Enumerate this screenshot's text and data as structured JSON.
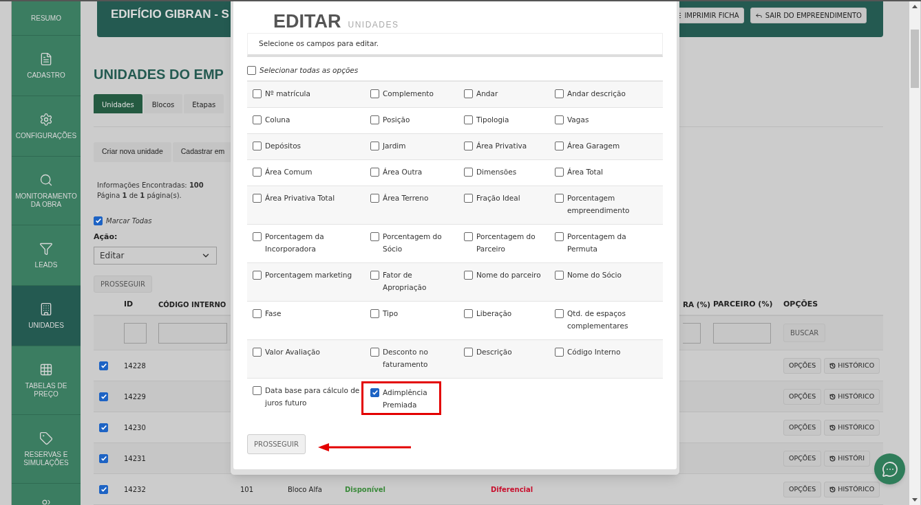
{
  "sidebar": {
    "items": [
      {
        "label": "RESUMO",
        "selected": false
      },
      {
        "label": "CADASTRO",
        "selected": false
      },
      {
        "label": "CONFIGURAÇÕES",
        "selected": false
      },
      {
        "label": "MONITORAMENTO DA OBRA",
        "selected": false
      },
      {
        "label": "LEADS",
        "selected": false
      },
      {
        "label": "UNIDADES",
        "selected": true
      },
      {
        "label": "TABELAS DE PREÇO",
        "selected": false
      },
      {
        "label": "RESERVAS E SIMULAÇÕES",
        "selected": false
      },
      {
        "selected": false
      }
    ]
  },
  "header": {
    "title": "EDIFÍCIO GIBRAN - S",
    "buttons": [
      {
        "label": "IMPRIMIR FICHA",
        "kind": "print"
      },
      {
        "label": "SAIR DO EMPREENDIMENTO",
        "kind": "exit"
      }
    ]
  },
  "page": {
    "title": "UNIDADES DO EMP",
    "tabs": [
      {
        "label": "Unidades",
        "selected": true
      },
      {
        "label": "Blocos",
        "selected": false
      },
      {
        "label": "Etapas",
        "selected": false
      }
    ],
    "actions": [
      "Criar nova unidade",
      "Cadastrar em"
    ],
    "info": [
      "Informações Encontradas: **100**",
      "Página **1** de **1** página(s)."
    ],
    "mark_all": {
      "label": "Marcar Todas",
      "checked": true
    },
    "action_label": "Ação:",
    "action_select": {
      "value": "Editar"
    },
    "proceed": "PROSSEGUIR"
  },
  "table": {
    "columns_left": [
      "ID",
      "CÓDIGO INTERNO"
    ],
    "columns_right": [
      "RA (%)",
      "PARCEIRO (%)",
      "OPÇÕES"
    ],
    "search_button": "BUSCAR",
    "rows": [
      {
        "checked": true,
        "id": "14228",
        "options": "OPÇÕES",
        "history": "HISTÓRICO"
      },
      {
        "checked": true,
        "id": "14229",
        "options": "OPÇÕES",
        "history": "HISTÓRICO"
      },
      {
        "checked": true,
        "id": "14230",
        "options": "OPÇÕES",
        "history": "HISTÓRICO"
      },
      {
        "checked": true,
        "id": "14231",
        "options": "OPÇÕES",
        "history": "HISTÓRI"
      },
      {
        "checked": true,
        "id": "14232",
        "cells": [
          "101",
          "Bloco Alfa"
        ],
        "status": "Disponível",
        "type": "Diferencial",
        "options": "OPÇÕES",
        "history": "HISTÓRICO"
      }
    ]
  },
  "modal": {
    "title": "EDITAR",
    "subtitle": "UNIDADES",
    "hint": "Selecione os campos para editar.",
    "select_all": {
      "label": "Selecionar todas as opções",
      "checked": false
    },
    "field_rows": [
      [
        {
          "label": "Nº matrícula",
          "checked": false,
          "highlighted": false
        },
        {
          "label": "Complemento",
          "checked": false,
          "highlighted": false
        },
        {
          "label": "Andar",
          "checked": false,
          "highlighted": false
        },
        {
          "label": "Andar descrição",
          "checked": false,
          "highlighted": false
        }
      ],
      [
        {
          "label": "Coluna",
          "checked": false,
          "highlighted": false
        },
        {
          "label": "Posição",
          "checked": false,
          "highlighted": false
        },
        {
          "label": "Tipologia",
          "checked": false,
          "highlighted": false
        },
        {
          "label": "Vagas",
          "checked": false,
          "highlighted": false
        }
      ],
      [
        {
          "label": "Depósitos",
          "checked": false,
          "highlighted": false
        },
        {
          "label": "Jardim",
          "checked": false,
          "highlighted": false
        },
        {
          "label": "Área Privativa",
          "checked": false,
          "highlighted": false
        },
        {
          "label": "Área Garagem",
          "checked": false,
          "highlighted": false
        }
      ],
      [
        {
          "label": "Área Comum",
          "checked": false,
          "highlighted": false
        },
        {
          "label": "Área Outra",
          "checked": false,
          "highlighted": false
        },
        {
          "label": "Dimensões",
          "checked": false,
          "highlighted": false
        },
        {
          "label": "Área Total",
          "checked": false,
          "highlighted": false
        }
      ],
      [
        {
          "label": "Área Privativa Total",
          "checked": false,
          "highlighted": false
        },
        {
          "label": "Área Terreno",
          "checked": false,
          "highlighted": false
        },
        {
          "label": "Fração Ideal",
          "checked": false,
          "highlighted": false
        },
        {
          "label": "Porcentagem empreendimento",
          "checked": false,
          "highlighted": false
        }
      ],
      [
        {
          "label": "Porcentagem da Incorporadora",
          "checked": false,
          "highlighted": false
        },
        {
          "label": "Porcentagem do Sócio",
          "checked": false,
          "highlighted": false
        },
        {
          "label": "Porcentagem do Parceiro",
          "checked": false,
          "highlighted": false
        },
        {
          "label": "Porcentagem da Permuta",
          "checked": false,
          "highlighted": false
        }
      ],
      [
        {
          "label": "Porcentagem marketing",
          "checked": false,
          "highlighted": false
        },
        {
          "label": "Fator de Apropriação",
          "checked": false,
          "highlighted": false
        },
        {
          "label": "Nome do parceiro",
          "checked": false,
          "highlighted": false
        },
        {
          "label": "Nome do Sócio",
          "checked": false,
          "highlighted": false
        }
      ],
      [
        {
          "label": "Fase",
          "checked": false,
          "highlighted": false
        },
        {
          "label": "Tipo",
          "checked": false,
          "highlighted": false
        },
        {
          "label": "Liberação",
          "checked": false,
          "highlighted": false
        },
        {
          "label": "Qtd. de espaços complementares",
          "checked": false,
          "highlighted": false
        }
      ],
      [
        {
          "label": "Valor Avaliação",
          "checked": false,
          "highlighted": false
        },
        {
          "label": "Desconto no faturamento",
          "checked": false,
          "highlighted": false
        },
        {
          "label": "Descrição",
          "checked": false,
          "highlighted": false
        },
        {
          "label": "Código Interno",
          "checked": false,
          "highlighted": false
        }
      ],
      [
        {
          "label": "Data base para cálculo de juros futuro",
          "checked": false,
          "highlighted": false
        },
        {
          "label": "Adimplência Premiada",
          "checked": true,
          "highlighted": true
        }
      ]
    ],
    "proceed": "PROSSEGUIR"
  }
}
